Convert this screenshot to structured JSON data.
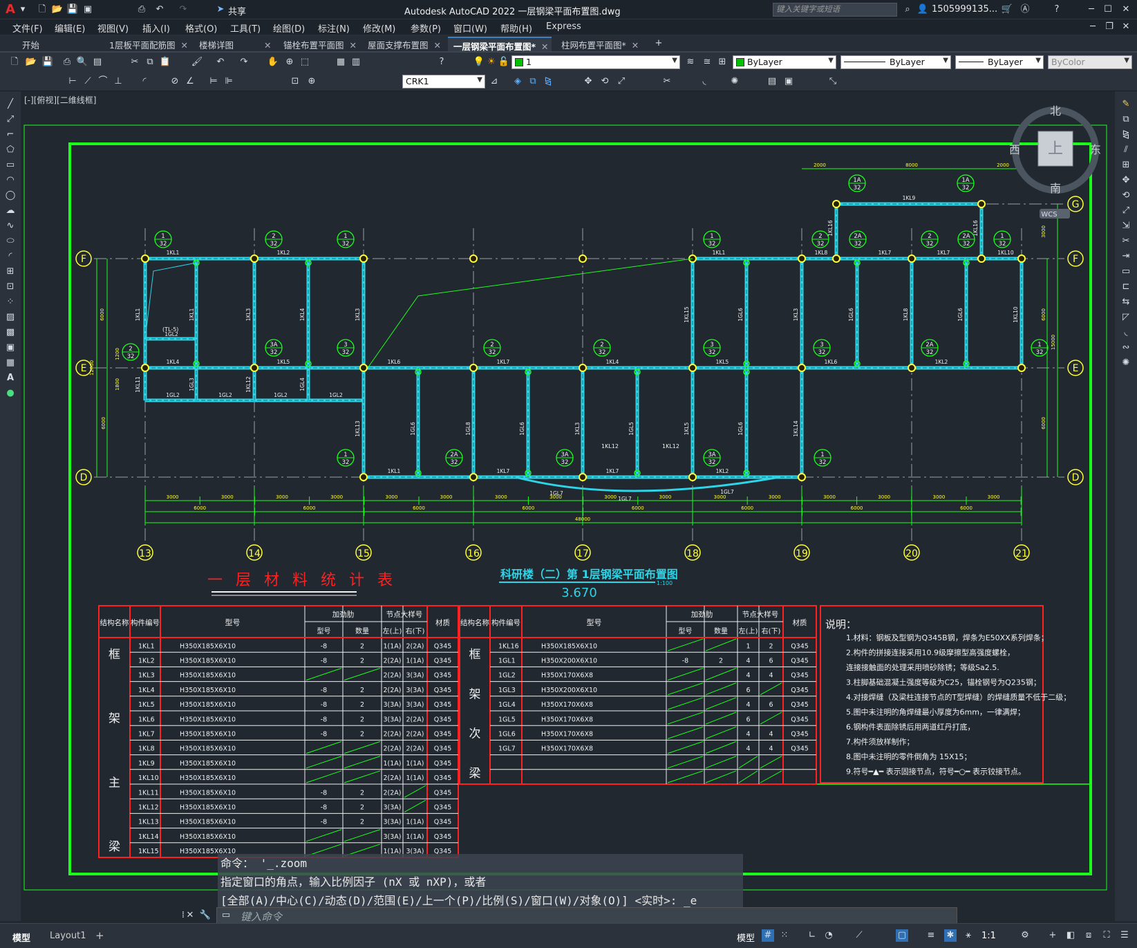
{
  "app": {
    "title": "Autodesk AutoCAD 2022    一层钢梁平面布置图.dwg",
    "search_placeholder": "键入关键字或短语",
    "user": "1505999135...",
    "share": "共享",
    "logo": "A"
  },
  "menu": [
    "文件(F)",
    "编辑(E)",
    "视图(V)",
    "插入(I)",
    "格式(O)",
    "工具(T)",
    "绘图(D)",
    "标注(N)",
    "修改(M)",
    "参数(P)",
    "窗口(W)",
    "帮助(H)",
    "Express"
  ],
  "tabs": [
    {
      "label": "开始",
      "active": false
    },
    {
      "label": "1层板平面配筋图",
      "active": false
    },
    {
      "label": "楼梯详图",
      "active": false
    },
    {
      "label": "锚栓布置平面图",
      "active": false
    },
    {
      "label": "屋面支撑布置图",
      "active": false
    },
    {
      "label": "一层钢梁平面布置图*",
      "active": true
    },
    {
      "label": "柱网布置平面图*",
      "active": false
    }
  ],
  "toolbar": {
    "layer_value": "1",
    "color": "ByLayer",
    "linetype": "ByLayer",
    "lineweight": "ByLayer",
    "plotstyle": "ByColor",
    "dimstyle": "CRK1"
  },
  "viewport_label": "[-][俯视][二维线框]",
  "viewcube": {
    "north": "北",
    "south": "南",
    "east": "东",
    "west": "西",
    "top": "上",
    "wcs": "WCS"
  },
  "drawing": {
    "title": "科研楼（二）第 1层钢梁平面布置图",
    "scale": "1:100",
    "elevation": "3.670",
    "table_title": "一 层 材 料 统 计 表",
    "axes_x": [
      "13",
      "14",
      "15",
      "16",
      "17",
      "18",
      "19",
      "20",
      "21"
    ],
    "axes_y": [
      "F",
      "E",
      "D",
      "G"
    ],
    "dim_total": "48000",
    "dims_3000": "3000",
    "dims_6000": "6000",
    "dims_top": [
      "2000",
      "8000",
      "2000"
    ],
    "dims_side": [
      "6000",
      "12000",
      "1800",
      "1200",
      "6000",
      "3000",
      "15000",
      "6000"
    ],
    "beam_labels": [
      "1KL1",
      "1KL2",
      "1KL3",
      "1KL4",
      "1KL5",
      "1KL6",
      "1KL7",
      "1KL8",
      "1KL9",
      "1KL10",
      "1KL11",
      "1KL12",
      "1KL13",
      "1KL14",
      "1KL15",
      "1KL16",
      "1GL1",
      "1GL2",
      "1GL3",
      "1GL4",
      "1GL5",
      "1GL6",
      "1GL7"
    ],
    "nodes": [
      "1",
      "2",
      "2A",
      "3",
      "3A",
      "1A"
    ],
    "node_den": "32"
  },
  "table_headers": {
    "cat": "结构名称",
    "code": "构件编号",
    "type": "型号",
    "stiff": "加劲肋",
    "stiff_type": "型号",
    "stiff_qty": "数量",
    "node": "节点大样号",
    "node_l": "左(上)",
    "node_r": "右(下)",
    "mat": "材质"
  },
  "table_left": {
    "category": [
      "框",
      "架",
      "主",
      "梁"
    ],
    "rows": [
      [
        "1KL1",
        "H350X185X6X10",
        "-8",
        "2",
        "1(1A)",
        "2(2A)",
        "Q345"
      ],
      [
        "1KL2",
        "H350X185X6X10",
        "-8",
        "2",
        "2(2A)",
        "1(1A)",
        "Q345"
      ],
      [
        "1KL3",
        "H350X185X6X10",
        "",
        "",
        "2(2A)",
        "3(3A)",
        "Q345"
      ],
      [
        "1KL4",
        "H350X185X6X10",
        "-8",
        "2",
        "2(2A)",
        "3(3A)",
        "Q345"
      ],
      [
        "1KL5",
        "H350X185X6X10",
        "-8",
        "2",
        "3(3A)",
        "3(3A)",
        "Q345"
      ],
      [
        "1KL6",
        "H350X185X6X10",
        "-8",
        "2",
        "3(3A)",
        "2(2A)",
        "Q345"
      ],
      [
        "1KL7",
        "H350X185X6X10",
        "-8",
        "2",
        "2(2A)",
        "2(2A)",
        "Q345"
      ],
      [
        "1KL8",
        "H350X185X6X10",
        "",
        "",
        "2(2A)",
        "2(2A)",
        "Q345"
      ],
      [
        "1KL9",
        "H350X185X6X10",
        "",
        "",
        "1(1A)",
        "1(1A)",
        "Q345"
      ],
      [
        "1KL10",
        "H350X185X6X10",
        "",
        "",
        "2(2A)",
        "1(1A)",
        "Q345"
      ],
      [
        "1KL11",
        "H350X185X6X10",
        "-8",
        "2",
        "2(2A)",
        "",
        "Q345"
      ],
      [
        "1KL12",
        "H350X185X6X10",
        "-8",
        "2",
        "3(3A)",
        "",
        "Q345"
      ],
      [
        "1KL13",
        "H350X185X6X10",
        "-8",
        "2",
        "3(3A)",
        "1(1A)",
        "Q345"
      ],
      [
        "1KL14",
        "H350X185X6X10",
        "",
        "",
        "3(3A)",
        "1(1A)",
        "Q345"
      ],
      [
        "1KL15",
        "H350X185X6X10",
        "",
        "",
        "1(1A)",
        "3(3A)",
        "Q345"
      ]
    ]
  },
  "table_right": {
    "category": [
      "框",
      "架",
      "次",
      "梁"
    ],
    "rows": [
      [
        "1KL16",
        "H350X185X6X10",
        "",
        "",
        "1",
        "2",
        "Q345"
      ],
      [
        "1GL1",
        "H350X200X6X10",
        "-8",
        "2",
        "4",
        "6",
        "Q345"
      ],
      [
        "1GL2",
        "H350X170X6X8",
        "",
        "",
        "4",
        "4",
        "Q345"
      ],
      [
        "1GL3",
        "H350X200X6X10",
        "",
        "",
        "6",
        "",
        "Q345"
      ],
      [
        "1GL4",
        "H350X170X6X8",
        "",
        "",
        "4",
        "6",
        "Q345"
      ],
      [
        "1GL5",
        "H350X170X6X8",
        "",
        "",
        "6",
        "",
        "Q345"
      ],
      [
        "1GL6",
        "H350X170X6X8",
        "",
        "",
        "4",
        "4",
        "Q345"
      ],
      [
        "1GL7",
        "H350X170X6X8",
        "",
        "",
        "4",
        "4",
        "Q345"
      ]
    ]
  },
  "notes": {
    "title": "说明：",
    "items": [
      "1.材料：钢板及型钢为Q345B钢，焊条为E50XX系列焊条；",
      "2.构件的拼接连接采用10.9级摩擦型高强度螺栓，",
      "   连接接触面的处理采用喷砂除锈；等级Sa2.5.",
      "3.柱脚基础混凝土强度等级为C25，锚栓钢号为Q235钢；",
      "4.对接焊缝（及梁柱连接节点的T型焊缝）的焊缝质量不低于二级；",
      "5.图中未注明的角焊缝最小厚度为6mm，一律满焊；",
      "6.钢构件表面除锈后用两道红丹打底，",
      "7.构件须放样制作；",
      "8.图中未注明的零件倒角为 15X15；",
      "9.符号━▲━ 表示固接节点，符号━○━ 表示铰接节点。"
    ]
  },
  "command": {
    "history": [
      "命令： '_.zoom",
      "指定窗口的角点，输入比例因子 (nX 或 nXP)，或者",
      "[全部(A)/中心(C)/动态(D)/范围(E)/上一个(P)/比例(S)/窗口(W)/对象(O)] <实时>: _e"
    ],
    "placeholder": "键入命令"
  },
  "layout_tabs": [
    "模型",
    "Layout1",
    "+"
  ],
  "status": {
    "model": "模型",
    "scale": "1:1"
  }
}
